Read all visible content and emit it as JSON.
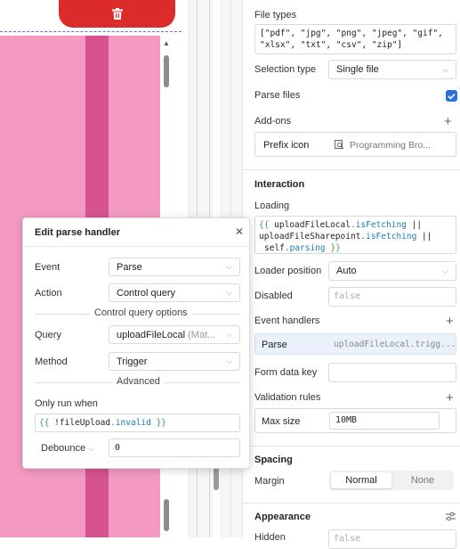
{
  "canvas": {
    "delete_icon": "trash-icon",
    "colors": {
      "pink": "#f49ac2",
      "stripe": "#d5548f",
      "delete": "#dc2b2b"
    }
  },
  "inspector": {
    "file_types_label": "File types",
    "file_types_value_1": "[\"pdf\", \"jpg\", \"png\", \"jpeg\", \"gif\",",
    "file_types_value_2": "\"xlsx\", \"txt\", \"csv\", \"zip\"]",
    "selection_type_label": "Selection type",
    "selection_type_value": "Single file",
    "parse_files_label": "Parse files",
    "parse_files_checked": true,
    "addons_label": "Add-ons",
    "prefix_icon_label": "Prefix icon",
    "prefix_icon_value": "Programming Bro...",
    "interaction_heading": "Interaction",
    "loading_label": "Loading",
    "loading_line1_a": "{{ ",
    "loading_line1_b": "uploadFileLocal",
    "loading_line1_c": ".isFetching",
    "loading_line1_d": " ||",
    "loading_line2_a": "uploadFileSharepoint",
    "loading_line2_b": ".isFetching",
    "loading_line2_c": " ||",
    "loading_line3_a": "self",
    "loading_line3_b": ".parsing",
    "loading_line3_c": " }}",
    "loader_position_label": "Loader position",
    "loader_position_value": "Auto",
    "disabled_label": "Disabled",
    "disabled_placeholder": "false",
    "event_handlers_label": "Event handlers",
    "handler_event": "Parse",
    "handler_action": "uploadFileLocal.trigg...",
    "form_data_key_label": "Form data key",
    "validation_rules_label": "Validation rules",
    "max_size_label": "Max size",
    "max_size_value": "10MB",
    "spacing_heading": "Spacing",
    "margin_label": "Margin",
    "margin_normal": "Normal",
    "margin_none": "None",
    "appearance_heading": "Appearance",
    "hidden_label": "Hidden",
    "hidden_placeholder": "false"
  },
  "modal": {
    "title": "Edit parse handler",
    "event_label": "Event",
    "event_value": "Parse",
    "action_label": "Action",
    "action_value": "Control query",
    "control_query_options": "Control query options",
    "query_label": "Query",
    "query_value": "uploadFileLocal",
    "query_hint": "(Mat...",
    "method_label": "Method",
    "method_value": "Trigger",
    "advanced_label": "Advanced",
    "only_run_when_label": "Only run when",
    "only_run_a": "{{ ",
    "only_run_b": "!fileUpload",
    "only_run_c": ".invalid",
    "only_run_d": " }}",
    "debounce_label": "Debounce",
    "debounce_value": "0"
  }
}
